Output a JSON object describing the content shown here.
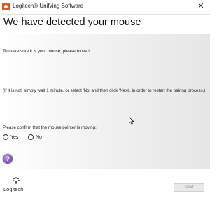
{
  "window": {
    "title": "Logitech® Unifying Software",
    "close_glyph": "✕"
  },
  "header": {
    "title": "We have detected your mouse"
  },
  "main": {
    "instruction": "To make sure it is your mouse, please move it.",
    "fallback_note": "(If it is not, simply wait 1 minute, or select 'No' and then click 'Next', in order to restart the pairing process.)",
    "confirm_prompt": "Please confirm that the mouse pointer is moving:",
    "options": [
      "Yes",
      "No"
    ],
    "help_glyph": "?"
  },
  "footer": {
    "logo_text": "Logitech",
    "next_label": "Next"
  },
  "colors": {
    "logo_accent": "#e8551c",
    "help_button": "#7a52b8",
    "next_disabled_text": "#9a9a9a"
  },
  "icons": [
    "logitech-app-icon",
    "close-icon",
    "help-icon",
    "mouse-cursor-icon",
    "logitech-logo-icon"
  ]
}
